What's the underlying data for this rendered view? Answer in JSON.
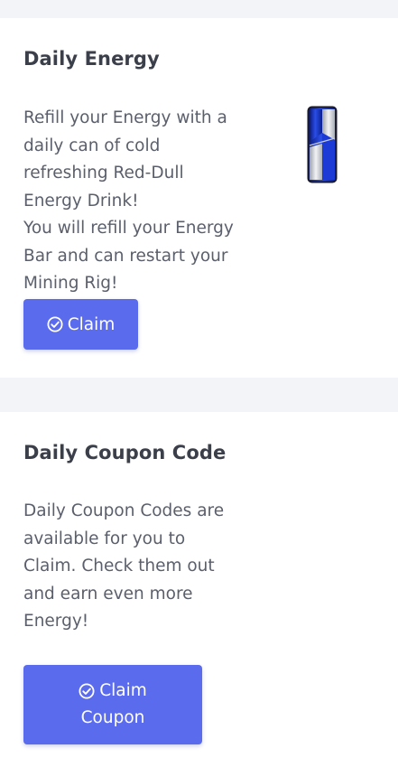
{
  "energy_card": {
    "title": "Daily Energy",
    "description_lines": [
      "Refill your Energy with a",
      "daily can of cold",
      "refreshing Red-Dull",
      "Energy Drink!",
      "You will refill your Energy",
      "Bar and can restart your",
      "Mining Rig!"
    ],
    "button": {
      "icon": "check-circle-icon",
      "label": "Claim"
    },
    "image": "energy-drink-can"
  },
  "coupon_card": {
    "title": "Daily Coupon Code",
    "description_lines": [
      "Daily Coupon Codes are",
      "available for you to",
      "Claim. Check them out",
      "and earn even more",
      "Energy!"
    ],
    "button": {
      "icon": "check-circle-icon",
      "label_line1": "Claim",
      "label_line2": "Coupon"
    }
  },
  "colors": {
    "page_background": "#f3f4f8",
    "card_background": "#ffffff",
    "title": "#3b3f4a",
    "body_text": "#5a5f6b",
    "button": "#5b6bee",
    "button_text": "#ffffff"
  }
}
